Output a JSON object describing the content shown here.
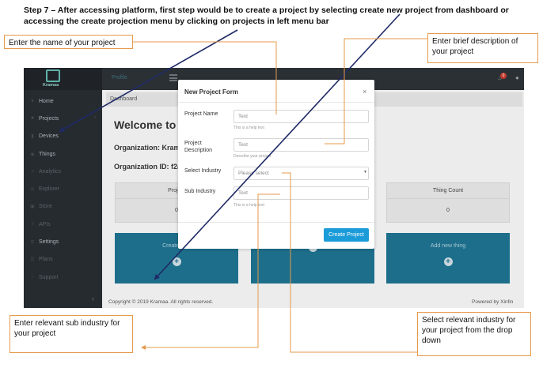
{
  "instruction": {
    "title": "Step 7 – After accessing platform, first step would be to create a project by selecting create  new project from dashboard or accessing the create projection menu by clicking on projects in left menu bar"
  },
  "callouts": {
    "name": "Enter the name of your project",
    "description": "Enter brief description of your project",
    "sub_industry": "Enter relevant sub industry for your project",
    "industry": "Select relevant industry for your project from the drop down"
  },
  "app": {
    "logo_text": "Kramaa",
    "topbar": {
      "profile_label": "Profile",
      "notification_count": "0"
    },
    "sidebar": {
      "items": [
        {
          "label": "Home",
          "icon": "home-icon"
        },
        {
          "label": "Projects",
          "icon": "folder-icon"
        },
        {
          "label": "Devices",
          "icon": "device-icon"
        },
        {
          "label": "Things",
          "icon": "cube-icon"
        },
        {
          "label": "Analytics",
          "icon": "chart-icon"
        },
        {
          "label": "Explorer",
          "icon": "binoculars-icon"
        },
        {
          "label": "Store",
          "icon": "cart-icon"
        },
        {
          "label": "APIs",
          "icon": "api-icon"
        },
        {
          "label": "Settings",
          "icon": "gear-icon"
        },
        {
          "label": "Plans",
          "icon": "plan-icon"
        },
        {
          "label": "Support",
          "icon": "support-icon"
        }
      ]
    },
    "breadcrumb": "Dashboard",
    "welcome": "Welcome to",
    "org_name": "Organization: Krama",
    "org_id": "Organization ID: f2a",
    "stats": [
      {
        "label": "Project",
        "value": "0"
      },
      {
        "label": "",
        "value": ""
      },
      {
        "label": "Thing Count",
        "value": "0"
      }
    ],
    "actions": [
      {
        "label": "Create new"
      },
      {
        "label": ""
      },
      {
        "label": "Add new thing"
      }
    ],
    "footer": {
      "copyright": "Copyright © 2019 Kramaa. All rights reserved.",
      "powered_by": "Powered by Xinfin"
    }
  },
  "modal": {
    "title": "New Project Form",
    "close": "×",
    "fields": {
      "project_name": {
        "label": "Project Name",
        "placeholder": "Text",
        "help": "This is a help text"
      },
      "project_description": {
        "label": "Project Description",
        "placeholder": "Text",
        "help": "Describe your project"
      },
      "industry": {
        "label": "Select Industry",
        "placeholder": "Please select"
      },
      "sub_industry": {
        "label": "Sub Industry",
        "placeholder": "Text",
        "help": "This is a help text"
      }
    },
    "submit": "Create Project"
  },
  "colors": {
    "sidebar_bg": "#262b30",
    "action_card": "#1d6e8b",
    "primary_button": "#1b9bd8",
    "callout_border": "#e59a4c",
    "arrow": "#1f2a66"
  }
}
